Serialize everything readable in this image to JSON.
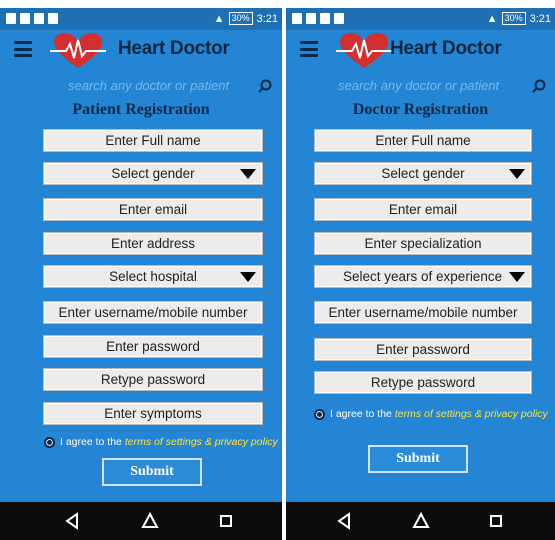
{
  "status_bar": {
    "battery": "30%",
    "time": "3:21"
  },
  "app": {
    "title": "Heart Doctor",
    "search_placeholder": "search any doctor or patient",
    "accent": "#2385d3"
  },
  "patient": {
    "title": "Patient Registration",
    "fields": [
      "Enter Full name",
      "Select gender",
      "Enter email",
      "Enter address",
      "Select hospital",
      "Enter username/mobile number",
      "Enter password",
      "Retype password",
      "Enter symptoms"
    ],
    "agree_prefix": "I agree to the",
    "agree_link": "terms of settings & privacy policy",
    "submit": "Submit"
  },
  "doctor": {
    "title": "Doctor Registration",
    "fields": [
      "Enter Full name",
      "Select gender",
      "Enter email",
      "Enter specialization",
      "Select years of experience",
      "Enter username/mobile number",
      "Enter password",
      "Retype password"
    ],
    "agree_prefix": "I agree to the",
    "agree_link": "terms of settings & privacy policy",
    "submit": "Submit"
  },
  "icons": [
    "menu-icon",
    "heart-logo-icon",
    "search-icon",
    "dropdown-arrow-icon",
    "back-icon",
    "home-icon",
    "recents-icon"
  ]
}
